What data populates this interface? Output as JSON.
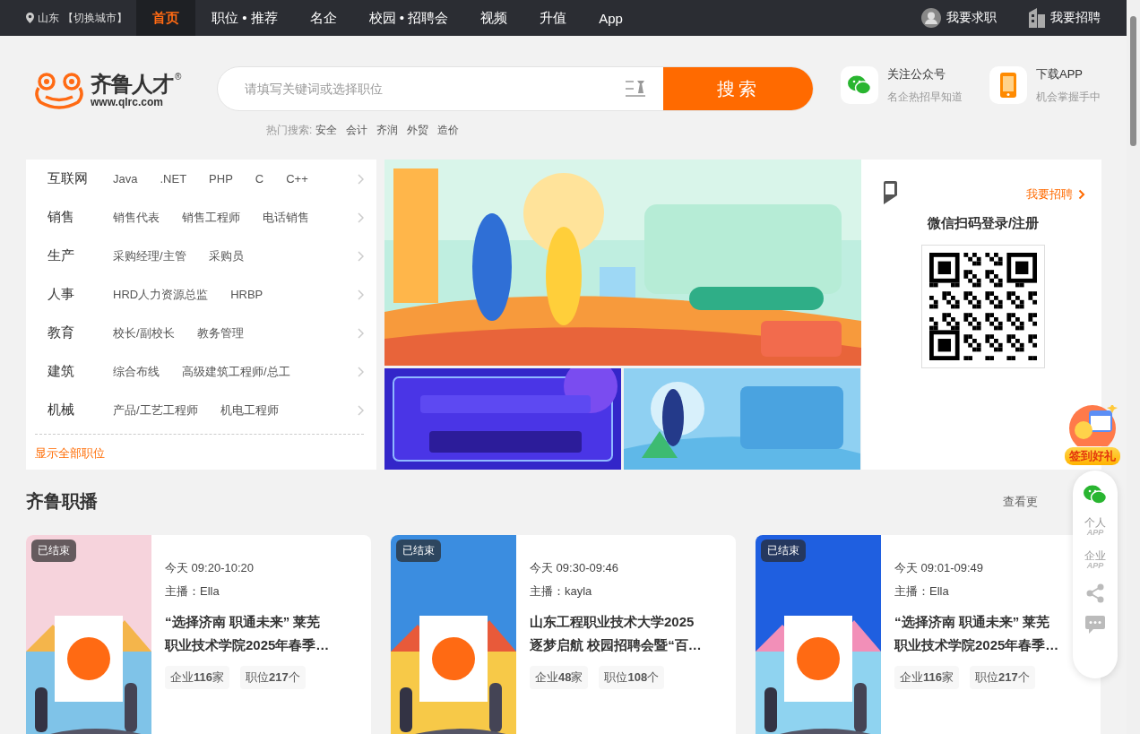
{
  "top_bar": {
    "location": "山东",
    "switch_city": "【切换城市】",
    "nav": [
      {
        "label": "首页",
        "selected": true
      },
      {
        "label": "职位 • 推荐",
        "selected": false
      },
      {
        "label": "名企",
        "selected": false
      },
      {
        "label": "校园 • 招聘会",
        "selected": false
      },
      {
        "label": "视频",
        "selected": false
      },
      {
        "label": "升值",
        "selected": false
      },
      {
        "label": "App",
        "selected": false
      }
    ],
    "user_links": [
      {
        "label": "我要求职",
        "kind": "seeker"
      },
      {
        "label": "我要招聘",
        "kind": "recruiter"
      }
    ]
  },
  "header": {
    "logo": {
      "name": "齐鲁人才",
      "url": "www.qlrc.com",
      "mark": "®"
    },
    "search": {
      "placeholder": "请填写关键词或选择职位",
      "button": "搜索"
    },
    "hot_searches": {
      "label": "热门搜索:",
      "items": [
        "安全",
        "会计",
        "齐润",
        "外贸",
        "造价"
      ]
    },
    "promos": [
      {
        "kind": "wechat",
        "title": "关注公众号",
        "subtitle": "名企热招早知道"
      },
      {
        "kind": "app",
        "title": "下载APP",
        "subtitle": "机会掌握手中"
      }
    ]
  },
  "categories": [
    {
      "name": "互联网",
      "jobs": [
        "Java",
        ".NET",
        "PHP",
        "C",
        "C++"
      ]
    },
    {
      "name": "销售",
      "jobs": [
        "销售代表",
        "销售工程师",
        "电话销售"
      ]
    },
    {
      "name": "生产",
      "jobs": [
        "采购经理/主管",
        "采购员"
      ]
    },
    {
      "name": "人事",
      "jobs": [
        "HRD人力资源总监",
        "HRBP"
      ]
    },
    {
      "name": "教育",
      "jobs": [
        "校长/副校长",
        "教务管理"
      ]
    },
    {
      "name": "建筑",
      "jobs": [
        "综合布线",
        "高级建筑工程师/总工"
      ]
    },
    {
      "name": "机械",
      "jobs": [
        "产品/工艺工程师",
        "机电工程师"
      ]
    }
  ],
  "show_all": "显示全部职位",
  "login_panel": {
    "link": "我要招聘",
    "title": "微信扫码登录/注册"
  },
  "live": {
    "title": "齐鲁职播",
    "more": "查看更",
    "cards": [
      {
        "status": "已结束",
        "time": "今天 09:20-10:20",
        "host_label": "主播：",
        "host": "Ella",
        "title": [
          "“选择济南 职通未来” 莱芜",
          "职业技术学院2025年春季…"
        ],
        "companies": "企业**116**家",
        "positions": "职位**217**个"
      },
      {
        "status": "已结束",
        "time": "今天 09:30-09:46",
        "host_label": "主播：",
        "host": "kayla",
        "title": [
          "山东工程职业技术大学2025",
          "逐梦启航 校园招聘会暨“百…"
        ],
        "companies": "企业**48**家",
        "positions": "职位**108**个"
      },
      {
        "status": "已结束",
        "time": "今天 09:01-09:49",
        "host_label": "主播：",
        "host": "Ella",
        "title": [
          "“选择济南 职通未来” 莱芜",
          "职业技术学院2025年春季…"
        ],
        "companies": "企业**116**家",
        "positions": "职位**217**个"
      }
    ]
  },
  "float_bar": {
    "items": [
      {
        "kind": "wechat"
      },
      {
        "kind": "app",
        "label": "个人",
        "sub": "APP"
      },
      {
        "kind": "app",
        "label": "企业",
        "sub": "APP"
      },
      {
        "kind": "share"
      },
      {
        "kind": "chat"
      }
    ]
  },
  "sign_badge": "签到好礼"
}
